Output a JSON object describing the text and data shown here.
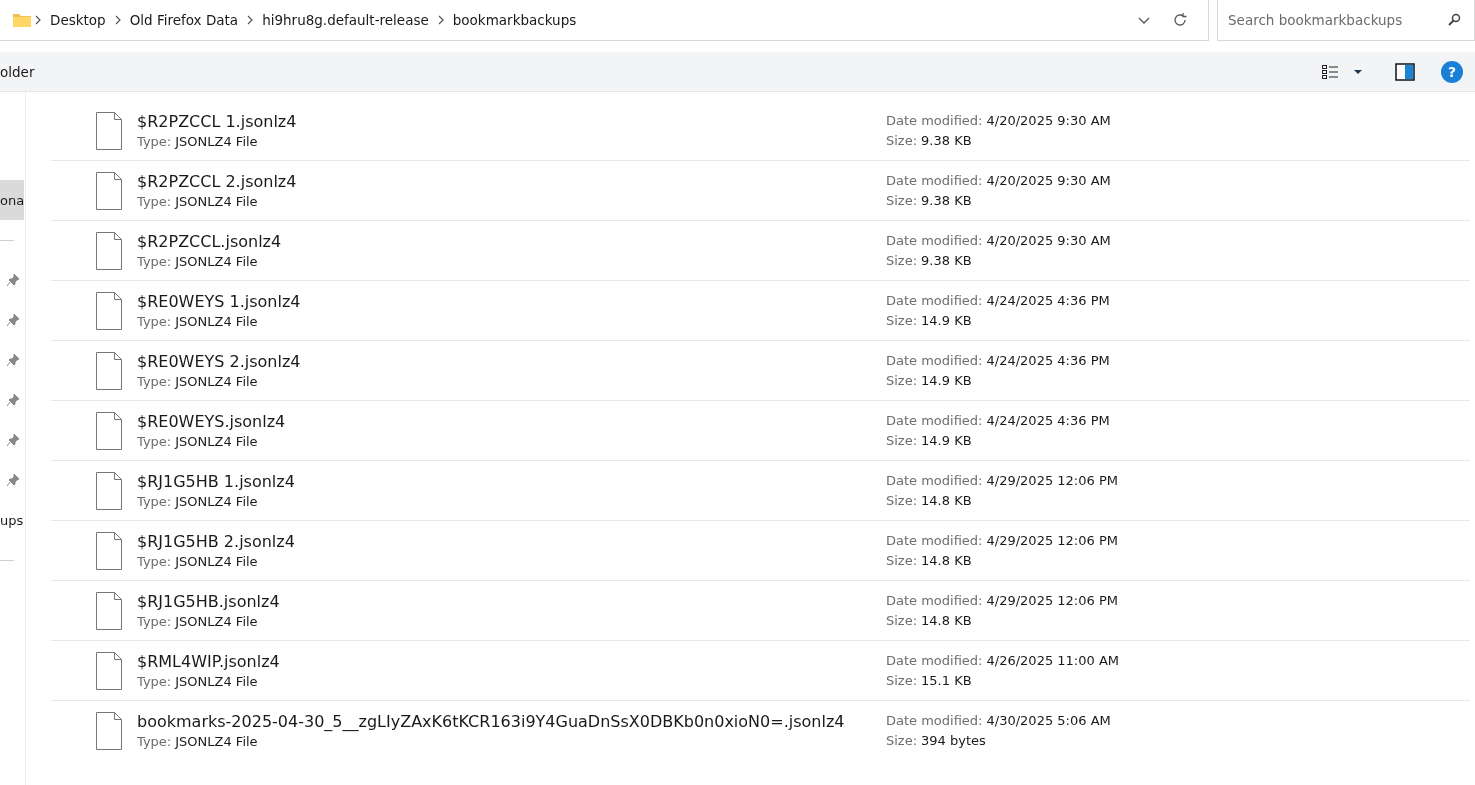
{
  "address_bar": {
    "crumbs": [
      "Desktop",
      "Old Firefox Data",
      "hi9hru8g.default-release",
      "bookmarkbackups"
    ]
  },
  "search": {
    "placeholder": "Search bookmarkbackups"
  },
  "toolbar": {
    "left_text": "older",
    "help": "?"
  },
  "sidebar": {
    "items": [
      {
        "kind": "text",
        "label": "ona",
        "selected": true
      },
      {
        "kind": "divider"
      },
      {
        "kind": "pin"
      },
      {
        "kind": "pin"
      },
      {
        "kind": "pin"
      },
      {
        "kind": "pin"
      },
      {
        "kind": "pin"
      },
      {
        "kind": "pin"
      },
      {
        "kind": "text",
        "label": "ups",
        "selected": false
      },
      {
        "kind": "divider"
      }
    ]
  },
  "files": [
    {
      "name": "$R2PZCCL 1.jsonlz4",
      "type_label": "Type:",
      "type": "JSONLZ4 File",
      "date_label": "Date modified:",
      "date": "4/20/2025 9:30 AM",
      "size_label": "Size:",
      "size": "9.38 KB"
    },
    {
      "name": "$R2PZCCL 2.jsonlz4",
      "type_label": "Type:",
      "type": "JSONLZ4 File",
      "date_label": "Date modified:",
      "date": "4/20/2025 9:30 AM",
      "size_label": "Size:",
      "size": "9.38 KB"
    },
    {
      "name": "$R2PZCCL.jsonlz4",
      "type_label": "Type:",
      "type": "JSONLZ4 File",
      "date_label": "Date modified:",
      "date": "4/20/2025 9:30 AM",
      "size_label": "Size:",
      "size": "9.38 KB"
    },
    {
      "name": "$RE0WEYS 1.jsonlz4",
      "type_label": "Type:",
      "type": "JSONLZ4 File",
      "date_label": "Date modified:",
      "date": "4/24/2025 4:36 PM",
      "size_label": "Size:",
      "size": "14.9 KB"
    },
    {
      "name": "$RE0WEYS 2.jsonlz4",
      "type_label": "Type:",
      "type": "JSONLZ4 File",
      "date_label": "Date modified:",
      "date": "4/24/2025 4:36 PM",
      "size_label": "Size:",
      "size": "14.9 KB"
    },
    {
      "name": "$RE0WEYS.jsonlz4",
      "type_label": "Type:",
      "type": "JSONLZ4 File",
      "date_label": "Date modified:",
      "date": "4/24/2025 4:36 PM",
      "size_label": "Size:",
      "size": "14.9 KB"
    },
    {
      "name": "$RJ1G5HB 1.jsonlz4",
      "type_label": "Type:",
      "type": "JSONLZ4 File",
      "date_label": "Date modified:",
      "date": "4/29/2025 12:06 PM",
      "size_label": "Size:",
      "size": "14.8 KB"
    },
    {
      "name": "$RJ1G5HB 2.jsonlz4",
      "type_label": "Type:",
      "type": "JSONLZ4 File",
      "date_label": "Date modified:",
      "date": "4/29/2025 12:06 PM",
      "size_label": "Size:",
      "size": "14.8 KB"
    },
    {
      "name": "$RJ1G5HB.jsonlz4",
      "type_label": "Type:",
      "type": "JSONLZ4 File",
      "date_label": "Date modified:",
      "date": "4/29/2025 12:06 PM",
      "size_label": "Size:",
      "size": "14.8 KB"
    },
    {
      "name": "$RML4WIP.jsonlz4",
      "type_label": "Type:",
      "type": "JSONLZ4 File",
      "date_label": "Date modified:",
      "date": "4/26/2025 11:00 AM",
      "size_label": "Size:",
      "size": "15.1 KB"
    },
    {
      "name": "bookmarks-2025-04-30_5__zgLIyZAxK6tKCR163i9Y4GuaDnSsX0DBKb0n0xioN0=.jsonlz4",
      "type_label": "Type:",
      "type": "JSONLZ4 File",
      "date_label": "Date modified:",
      "date": "4/30/2025 5:06 AM",
      "size_label": "Size:",
      "size": "394 bytes"
    }
  ]
}
